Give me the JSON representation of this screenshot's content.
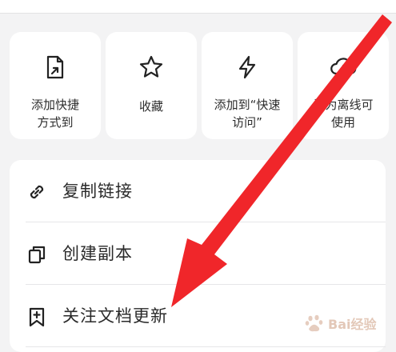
{
  "quick_actions": [
    {
      "label": "添加快捷\n方式到",
      "icon": "shortcut-icon"
    },
    {
      "label": "收藏",
      "icon": "star-icon"
    },
    {
      "label": "添加到“快速\n访问”",
      "icon": "lightning-icon"
    },
    {
      "label": "设为离线可\n使用",
      "icon": "cloud-download-icon"
    }
  ],
  "menu": [
    {
      "label": "复制链接",
      "icon": "link-icon"
    },
    {
      "label": "创建副本",
      "icon": "copy-icon"
    },
    {
      "label": "关注文档更新",
      "icon": "bookmark-plus-icon"
    }
  ],
  "annotation": {
    "arrow_color": "#f0262a"
  },
  "watermark": {
    "text": "Bai经验"
  }
}
